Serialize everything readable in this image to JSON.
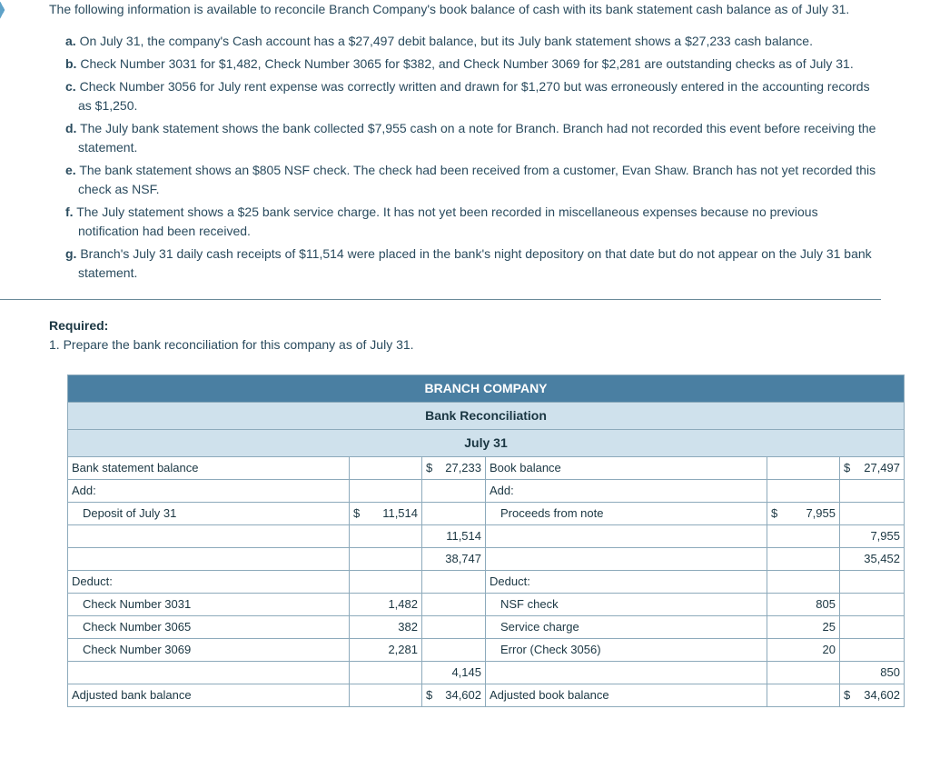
{
  "problem": {
    "intro": "The following information is available to reconcile Branch Company's book balance of cash with its bank statement cash balance as of July 31.",
    "items": [
      {
        "lbl": "a.",
        "text": "On July 31, the company's Cash account has a $27,497 debit balance, but its July bank statement shows a $27,233 cash balance."
      },
      {
        "lbl": "b.",
        "text": "Check Number 3031 for $1,482, Check Number 3065 for $382, and Check Number 3069 for $2,281 are outstanding checks as of July 31."
      },
      {
        "lbl": "c.",
        "text": "Check Number 3056 for July rent expense was correctly written and drawn for $1,270 but was erroneously entered in the accounting records as $1,250."
      },
      {
        "lbl": "d.",
        "text": "The July bank statement shows the bank collected $7,955 cash on a note for Branch. Branch had not recorded this event before receiving the statement."
      },
      {
        "lbl": "e.",
        "text": "The bank statement shows an $805 NSF check. The check had been received from a customer, Evan Shaw. Branch has not yet recorded this check as NSF."
      },
      {
        "lbl": "f.",
        "text": "The July statement shows a $25 bank service charge. It has not yet been recorded in miscellaneous expenses because no previous notification had been received."
      },
      {
        "lbl": "g.",
        "text": "Branch's July 31 daily cash receipts of $11,514 were placed in the bank's night depository on that date but do not appear on the July 31 bank statement."
      }
    ]
  },
  "required": {
    "hdr": "Required:",
    "item": "1. Prepare the bank reconciliation for this company as of July 31."
  },
  "table": {
    "title": "BRANCH COMPANY",
    "sub1": "Bank Reconciliation",
    "sub2": "July 31",
    "left": {
      "balance_lbl": "Bank statement balance",
      "balance_sym": "$",
      "balance_val": "27,233",
      "add_lbl": "Add:",
      "add_items": [
        {
          "lbl": "Deposit of July 31",
          "sym": "$",
          "val": "11,514"
        }
      ],
      "add_total": "11,514",
      "running": "38,747",
      "deduct_lbl": "Deduct:",
      "deduct_items": [
        {
          "lbl": "Check Number 3031",
          "val": "1,482"
        },
        {
          "lbl": "Check Number 3065",
          "val": "382"
        },
        {
          "lbl": "Check Number 3069",
          "val": "2,281"
        }
      ],
      "deduct_total": "4,145",
      "adjusted_lbl": "Adjusted bank balance",
      "adjusted_sym": "$",
      "adjusted_val": "34,602"
    },
    "right": {
      "balance_lbl": "Book balance",
      "balance_sym": "$",
      "balance_val": "27,497",
      "add_lbl": "Add:",
      "add_items": [
        {
          "lbl": "Proceeds from note",
          "sym": "$",
          "val": "7,955"
        }
      ],
      "add_total": "7,955",
      "running": "35,452",
      "deduct_lbl": "Deduct:",
      "deduct_items": [
        {
          "lbl": "NSF check",
          "val": "805"
        },
        {
          "lbl": "Service charge",
          "val": "25"
        },
        {
          "lbl": "Error (Check 3056)",
          "val": "20"
        }
      ],
      "deduct_total": "850",
      "adjusted_lbl": "Adjusted book balance",
      "adjusted_sym": "$",
      "adjusted_val": "34,602"
    }
  }
}
